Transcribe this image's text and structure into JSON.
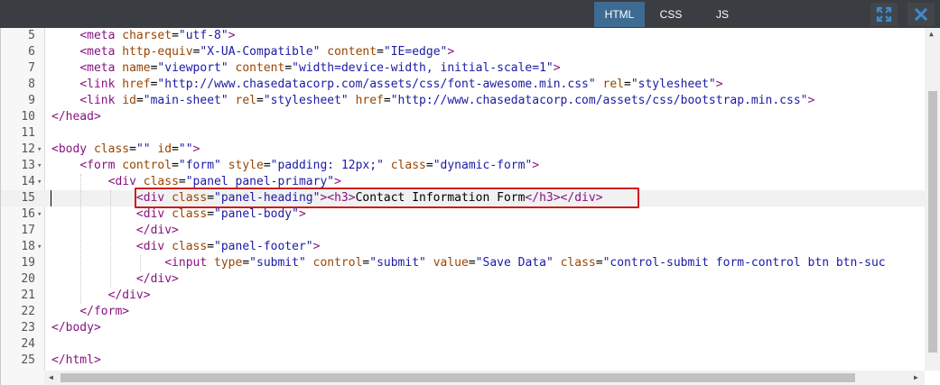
{
  "toolbar": {
    "tabs": [
      {
        "label": "HTML",
        "active": true
      },
      {
        "label": "CSS",
        "active": false
      },
      {
        "label": "JS",
        "active": false
      }
    ],
    "expand_icon": "expand-icon",
    "close_icon": "close-icon"
  },
  "editor": {
    "lines": [
      {
        "num": "5",
        "fold": ""
      },
      {
        "num": "6",
        "fold": ""
      },
      {
        "num": "7",
        "fold": ""
      },
      {
        "num": "8",
        "fold": ""
      },
      {
        "num": "9",
        "fold": ""
      },
      {
        "num": "10",
        "fold": ""
      },
      {
        "num": "11",
        "fold": ""
      },
      {
        "num": "12",
        "fold": "▾"
      },
      {
        "num": "13",
        "fold": "▾"
      },
      {
        "num": "14",
        "fold": "▾"
      },
      {
        "num": "15",
        "fold": ""
      },
      {
        "num": "16",
        "fold": "▾"
      },
      {
        "num": "17",
        "fold": ""
      },
      {
        "num": "18",
        "fold": "▾"
      },
      {
        "num": "19",
        "fold": ""
      },
      {
        "num": "20",
        "fold": ""
      },
      {
        "num": "21",
        "fold": ""
      },
      {
        "num": "22",
        "fold": ""
      },
      {
        "num": "23",
        "fold": ""
      },
      {
        "num": "24",
        "fold": ""
      },
      {
        "num": "25",
        "fold": ""
      }
    ],
    "code": [
      [
        [
          "",
          "    "
        ],
        [
          "t",
          "<meta "
        ],
        [
          "a",
          "charset"
        ],
        [
          "tx",
          "="
        ],
        [
          "v",
          "\"utf-8\""
        ],
        [
          "t",
          ">"
        ]
      ],
      [
        [
          "",
          "    "
        ],
        [
          "t",
          "<meta "
        ],
        [
          "a",
          "http-equiv"
        ],
        [
          "tx",
          "="
        ],
        [
          "v",
          "\"X-UA-Compatible\""
        ],
        [
          "tx",
          " "
        ],
        [
          "a",
          "content"
        ],
        [
          "tx",
          "="
        ],
        [
          "v",
          "\"IE=edge\""
        ],
        [
          "t",
          ">"
        ]
      ],
      [
        [
          "",
          "    "
        ],
        [
          "t",
          "<meta "
        ],
        [
          "a",
          "name"
        ],
        [
          "tx",
          "="
        ],
        [
          "v",
          "\"viewport\""
        ],
        [
          "tx",
          " "
        ],
        [
          "a",
          "content"
        ],
        [
          "tx",
          "="
        ],
        [
          "v",
          "\"width=device-width, initial-scale=1\""
        ],
        [
          "t",
          ">"
        ]
      ],
      [
        [
          "",
          "    "
        ],
        [
          "t",
          "<link "
        ],
        [
          "a",
          "href"
        ],
        [
          "tx",
          "="
        ],
        [
          "v",
          "\"http://www.chasedatacorp.com/assets/css/font-awesome.min.css\""
        ],
        [
          "tx",
          " "
        ],
        [
          "a",
          "rel"
        ],
        [
          "tx",
          "="
        ],
        [
          "v",
          "\"stylesheet\""
        ],
        [
          "t",
          ">"
        ]
      ],
      [
        [
          "",
          "    "
        ],
        [
          "t",
          "<link "
        ],
        [
          "a",
          "id"
        ],
        [
          "tx",
          "="
        ],
        [
          "v",
          "\"main-sheet\""
        ],
        [
          "tx",
          " "
        ],
        [
          "a",
          "rel"
        ],
        [
          "tx",
          "="
        ],
        [
          "v",
          "\"stylesheet\""
        ],
        [
          "tx",
          " "
        ],
        [
          "a",
          "href"
        ],
        [
          "tx",
          "="
        ],
        [
          "v",
          "\"http://www.chasedatacorp.com/assets/css/bootstrap.min.css\""
        ],
        [
          "t",
          ">"
        ]
      ],
      [
        [
          "t",
          "</head>"
        ]
      ],
      [],
      [
        [
          "t",
          "<body "
        ],
        [
          "a",
          "class"
        ],
        [
          "tx",
          "="
        ],
        [
          "v",
          "\"\""
        ],
        [
          "tx",
          " "
        ],
        [
          "a",
          "id"
        ],
        [
          "tx",
          "="
        ],
        [
          "v",
          "\"\""
        ],
        [
          "t",
          ">"
        ]
      ],
      [
        [
          "",
          "    "
        ],
        [
          "t",
          "<form "
        ],
        [
          "a",
          "control"
        ],
        [
          "tx",
          "="
        ],
        [
          "v",
          "\"form\""
        ],
        [
          "tx",
          " "
        ],
        [
          "a",
          "style"
        ],
        [
          "tx",
          "="
        ],
        [
          "v",
          "\"padding: 12px;\""
        ],
        [
          "tx",
          " "
        ],
        [
          "a",
          "class"
        ],
        [
          "tx",
          "="
        ],
        [
          "v",
          "\"dynamic-form\""
        ],
        [
          "t",
          ">"
        ]
      ],
      [
        [
          "",
          "        "
        ],
        [
          "t",
          "<div "
        ],
        [
          "a",
          "class"
        ],
        [
          "tx",
          "="
        ],
        [
          "v",
          "\"panel panel-primary\""
        ],
        [
          "t",
          ">"
        ]
      ],
      [
        [
          "",
          "            "
        ],
        [
          "t",
          "<div "
        ],
        [
          "a",
          "class"
        ],
        [
          "tx",
          "="
        ],
        [
          "v",
          "\"panel-heading\""
        ],
        [
          "t",
          "><h3>"
        ],
        [
          "tx",
          "Contact Information Form"
        ],
        [
          "t",
          "</h3></div>"
        ]
      ],
      [
        [
          "",
          "            "
        ],
        [
          "t",
          "<div "
        ],
        [
          "a",
          "class"
        ],
        [
          "tx",
          "="
        ],
        [
          "v",
          "\"panel-body\""
        ],
        [
          "t",
          ">"
        ]
      ],
      [
        [
          "",
          "            "
        ],
        [
          "t",
          "</div>"
        ]
      ],
      [
        [
          "",
          "            "
        ],
        [
          "t",
          "<div "
        ],
        [
          "a",
          "class"
        ],
        [
          "tx",
          "="
        ],
        [
          "v",
          "\"panel-footer\""
        ],
        [
          "t",
          ">"
        ]
      ],
      [
        [
          "",
          "                "
        ],
        [
          "t",
          "<input "
        ],
        [
          "a",
          "type"
        ],
        [
          "tx",
          "="
        ],
        [
          "v",
          "\"submit\""
        ],
        [
          "tx",
          " "
        ],
        [
          "a",
          "control"
        ],
        [
          "tx",
          "="
        ],
        [
          "v",
          "\"submit\""
        ],
        [
          "tx",
          " "
        ],
        [
          "a",
          "value"
        ],
        [
          "tx",
          "="
        ],
        [
          "v",
          "\"Save Data\""
        ],
        [
          "tx",
          " "
        ],
        [
          "a",
          "class"
        ],
        [
          "tx",
          "="
        ],
        [
          "v",
          "\"control-submit form-control btn btn-suc"
        ]
      ],
      [
        [
          "",
          "            "
        ],
        [
          "t",
          "</div>"
        ]
      ],
      [
        [
          "",
          "        "
        ],
        [
          "t",
          "</div>"
        ]
      ],
      [
        [
          "",
          "    "
        ],
        [
          "t",
          "</form>"
        ]
      ],
      [
        [
          "t",
          "</body>"
        ]
      ],
      [],
      [
        [
          "t",
          "</html>"
        ]
      ]
    ]
  }
}
